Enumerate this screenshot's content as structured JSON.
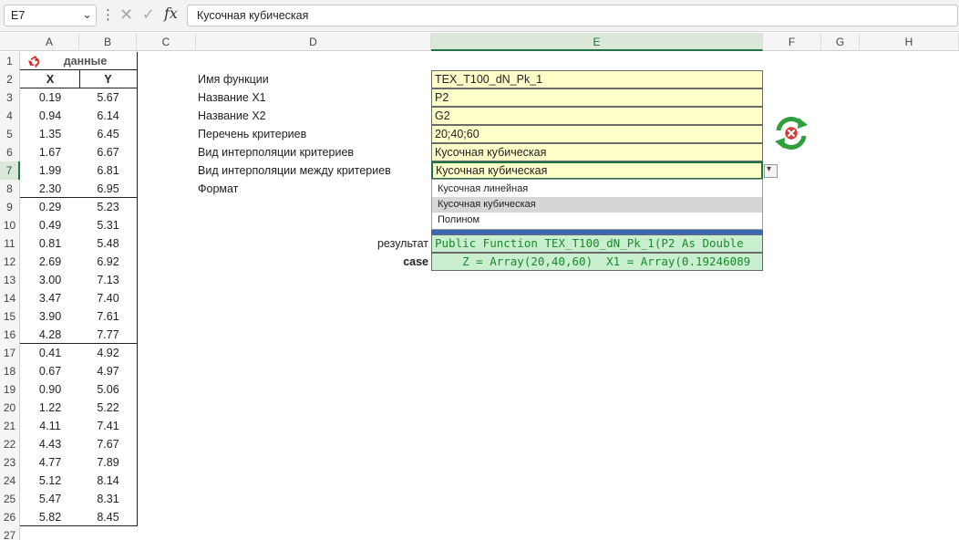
{
  "formula_bar": {
    "name_box": "E7",
    "dropdown_glyph": "⌄",
    "dots": "⋮",
    "cancel_glyph": "✕",
    "enter_glyph": "✓",
    "fx_label": "fx",
    "formula": "Кусочная кубическая"
  },
  "columns": [
    "A",
    "B",
    "C",
    "D",
    "E",
    "F",
    "G",
    "H"
  ],
  "active_column": "E",
  "active_row": "7",
  "rows": [
    "1",
    "2",
    "3",
    "4",
    "5",
    "6",
    "7",
    "8",
    "9",
    "10",
    "11",
    "12",
    "13",
    "14",
    "15",
    "16",
    "17",
    "18",
    "19",
    "20",
    "21",
    "22",
    "23",
    "24",
    "25",
    "26",
    "27"
  ],
  "data_table": {
    "title": "данные",
    "title_icon": "recycle-icon",
    "col_x": "X",
    "col_y": "Y",
    "rows": [
      [
        "0.19",
        "5.67"
      ],
      [
        "0.94",
        "6.14"
      ],
      [
        "1.35",
        "6.45"
      ],
      [
        "1.67",
        "6.67"
      ],
      [
        "1.99",
        "6.81"
      ],
      [
        "2.30",
        "6.95"
      ],
      [
        "0.29",
        "5.23"
      ],
      [
        "0.49",
        "5.31"
      ],
      [
        "0.81",
        "5.48"
      ],
      [
        "2.69",
        "6.92"
      ],
      [
        "3.00",
        "7.13"
      ],
      [
        "3.47",
        "7.40"
      ],
      [
        "3.90",
        "7.61"
      ],
      [
        "4.28",
        "7.77"
      ],
      [
        "0.41",
        "4.92"
      ],
      [
        "0.67",
        "4.97"
      ],
      [
        "0.90",
        "5.06"
      ],
      [
        "1.22",
        "5.22"
      ],
      [
        "4.11",
        "7.41"
      ],
      [
        "4.43",
        "7.67"
      ],
      [
        "4.77",
        "7.89"
      ],
      [
        "5.12",
        "8.14"
      ],
      [
        "5.47",
        "8.31"
      ],
      [
        "5.82",
        "8.45"
      ]
    ]
  },
  "form": {
    "labels": [
      "Имя функции",
      "Название X1",
      "Название X2",
      "Перечень критериев",
      "Вид интерполяции критериев",
      "Вид интерполяции между критериев",
      "Формат"
    ],
    "values": [
      "TEX_T100_dN_Pk_1",
      "P2",
      "G2",
      "20;40;60",
      "Кусочная кубическая",
      "Кусочная кубическая"
    ]
  },
  "dropdown": {
    "arrow": "▾",
    "options": [
      "Кусочная линейная",
      "Кусочная кубическая",
      "Полином"
    ],
    "selected_index": 1
  },
  "result": {
    "label_result": "результат",
    "label_case": "case",
    "line1": "Public Function TEX_T100_dN_Pk_1(P2 As Double",
    "line2": "    Z = Array(20,40,60)  X1 = Array(0.19246089"
  },
  "colors": {
    "input_fill": "#ffffc9",
    "result_fill": "#c9eed0",
    "result_text": "#1a8a2a",
    "active_header": "#217346",
    "button_blue": "#3a66b4",
    "refresh_green": "#2e9e3e",
    "refresh_red": "#d63a3a"
  },
  "icons": {
    "refresh": "refresh-cancel-icon"
  }
}
